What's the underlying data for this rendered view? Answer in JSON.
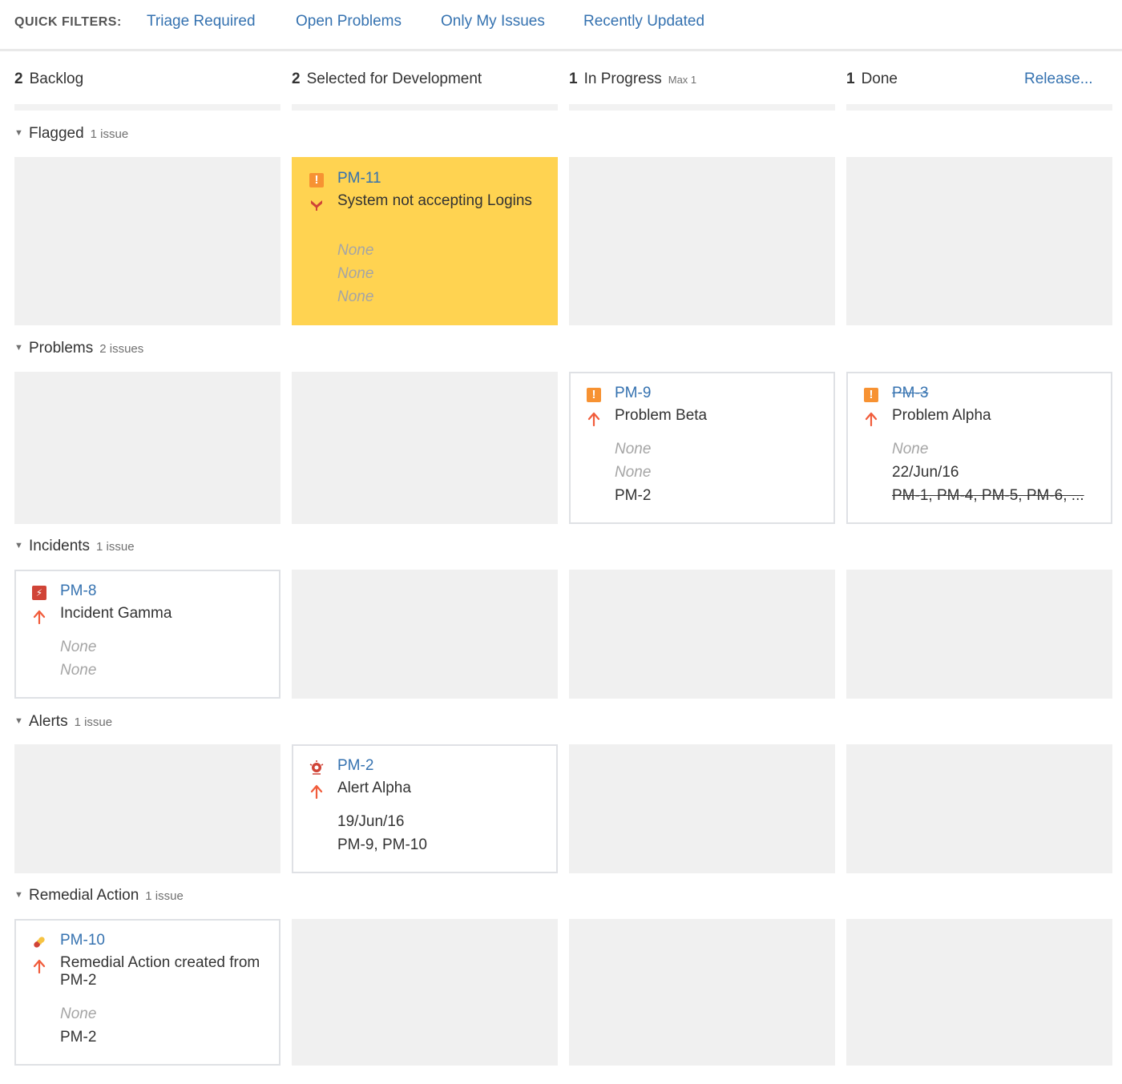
{
  "quick_filters": {
    "label": "QUICK FILTERS:",
    "items": [
      "Triage Required",
      "Open Problems",
      "Only My Issues",
      "Recently Updated"
    ]
  },
  "columns": [
    {
      "count": "2",
      "name": "Backlog",
      "max": ""
    },
    {
      "count": "2",
      "name": "Selected for Development",
      "max": ""
    },
    {
      "count": "1",
      "name": "In Progress",
      "max": "Max 1"
    },
    {
      "count": "1",
      "name": "Done",
      "max": ""
    }
  ],
  "release_link": "Release...",
  "swimlanes": [
    {
      "name": "Flagged",
      "count": "1 issue"
    },
    {
      "name": "Problems",
      "count": "2 issues"
    },
    {
      "name": "Incidents",
      "count": "1 issue"
    },
    {
      "name": "Alerts",
      "count": "1 issue"
    },
    {
      "name": "Remedial Action",
      "count": "1 issue"
    }
  ],
  "cards": {
    "pm11": {
      "key": "PM-11",
      "summary": "System not accepting Logins",
      "fields": [
        "None",
        "None",
        "None"
      ]
    },
    "pm9": {
      "key": "PM-9",
      "summary": "Problem Beta",
      "fields": [
        "None",
        "None",
        "PM-2"
      ]
    },
    "pm3": {
      "key": "PM-3",
      "summary": "Problem Alpha",
      "fields": [
        "None",
        "22/Jun/16",
        "PM-1, PM-4, PM-5, PM-6, ..."
      ]
    },
    "pm8": {
      "key": "PM-8",
      "summary": "Incident Gamma",
      "fields": [
        "None",
        "None"
      ]
    },
    "pm2": {
      "key": "PM-2",
      "summary": "Alert Alpha",
      "fields": [
        "19/Jun/16",
        "PM-9, PM-10"
      ]
    },
    "pm10": {
      "key": "PM-10",
      "summary": "Remedial Action created from PM-2",
      "fields": [
        "None",
        "PM-2"
      ]
    }
  },
  "colors": {
    "link": "#3572b0",
    "flagged_card": "#ffd351",
    "problem_icon": "#f79232",
    "incident_icon": "#d04437",
    "priority_arrow": "#f15c3b",
    "cell_bg": "#f0f0f0"
  }
}
